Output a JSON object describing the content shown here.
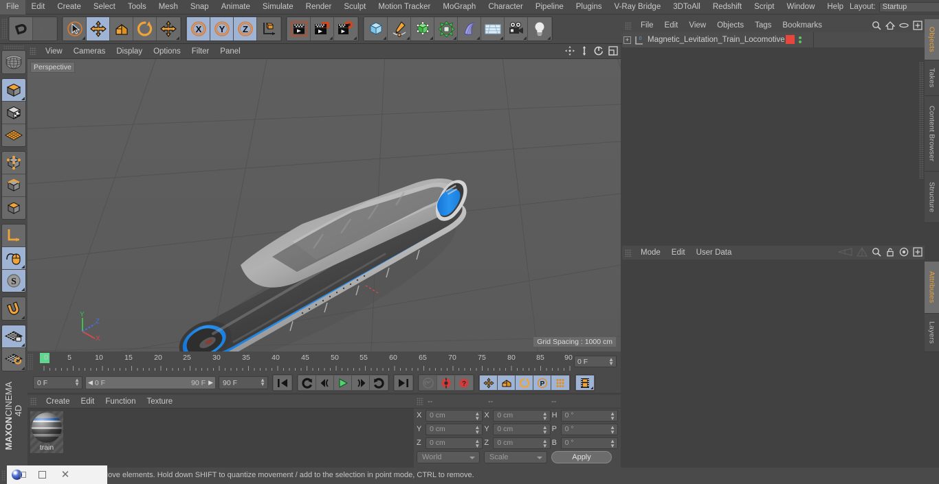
{
  "app": {
    "brand_top": "MAXON",
    "brand_bottom": "CINEMA 4D"
  },
  "menubar": {
    "items": [
      "File",
      "Edit",
      "Create",
      "Select",
      "Tools",
      "Mesh",
      "Snap",
      "Animate",
      "Simulate",
      "Render",
      "Sculpt",
      "Motion Tracker",
      "MoGraph",
      "Character",
      "Pipeline",
      "Plugins",
      "V-Ray Bridge",
      "3DToAll",
      "Redshift",
      "Script",
      "Window",
      "Help"
    ],
    "layout_label": "Layout:",
    "layout_value": "Startup",
    "search_icon": "search-icon"
  },
  "toolbar": {
    "groups": [
      {
        "name": "undo-redo",
        "buttons": [
          {
            "name": "undo-button",
            "icon": "undo-arrow-icon",
            "active": false,
            "dim": false
          },
          {
            "name": "redo-button",
            "icon": "redo-arrow-icon",
            "active": false,
            "dim": true
          }
        ]
      },
      {
        "name": "transform-tools",
        "buttons": [
          {
            "name": "live-selection-tool",
            "icon": "cursor-select-icon",
            "active": false,
            "corner": true
          },
          {
            "name": "move-tool",
            "icon": "move-arrows-icon",
            "active": true
          },
          {
            "name": "scale-tool",
            "icon": "scale-box-icon",
            "active": false
          },
          {
            "name": "rotate-tool",
            "icon": "rotate-circle-icon",
            "active": false
          },
          {
            "name": "move-alt-tool",
            "icon": "move-arrows-icon",
            "active": false,
            "corner": true
          }
        ]
      },
      {
        "name": "axis-locks",
        "buttons": [
          {
            "name": "lock-x-axis",
            "icon": "x-axis-icon",
            "active": true
          },
          {
            "name": "lock-y-axis",
            "icon": "y-axis-icon",
            "active": true
          },
          {
            "name": "lock-z-axis",
            "icon": "z-axis-icon",
            "active": true
          },
          {
            "name": "world-object-coordinates",
            "icon": "world-axis-icon",
            "active": false
          }
        ]
      },
      {
        "name": "render-group",
        "buttons": [
          {
            "name": "render-view-button",
            "icon": "render-view-icon",
            "active": false
          },
          {
            "name": "render-to-picture-viewer-button",
            "icon": "render-picture-icon",
            "active": false,
            "corner": true
          },
          {
            "name": "render-settings-button",
            "icon": "render-settings-icon",
            "active": false,
            "corner": true
          }
        ]
      },
      {
        "name": "create-group",
        "buttons": [
          {
            "name": "add-cube-button",
            "icon": "cube-primitive-icon",
            "active": false,
            "corner": true
          },
          {
            "name": "add-spline-button",
            "icon": "pen-spline-icon",
            "active": false,
            "corner": true
          },
          {
            "name": "add-generator-button",
            "icon": "generator-cube-icon",
            "active": false,
            "corner": true
          },
          {
            "name": "add-deformer-button",
            "icon": "deformer-icon",
            "active": false,
            "corner": true
          },
          {
            "name": "add-scene-object-button",
            "icon": "bend-object-icon",
            "active": false,
            "corner": true
          },
          {
            "name": "add-floor-button",
            "icon": "floor-grid-icon",
            "active": false,
            "corner": true
          },
          {
            "name": "add-camera-button",
            "icon": "camera-icon",
            "active": false,
            "corner": true
          },
          {
            "name": "add-light-button",
            "icon": "light-bulb-icon",
            "active": false,
            "corner": true
          }
        ]
      }
    ]
  },
  "left_toolbar": {
    "groups": [
      {
        "name": "render-region",
        "buttons": [
          {
            "name": "render-region-button",
            "icon": "globe-wire-icon",
            "active": false
          }
        ]
      },
      {
        "name": "editable-modes",
        "buttons": [
          {
            "name": "make-editable-button",
            "icon": "editable-cube-icon",
            "active": true,
            "corner": true
          },
          {
            "name": "texture-mode-button",
            "icon": "texture-checker-cube-icon",
            "active": false
          },
          {
            "name": "viewport-solo-button",
            "icon": "grid-plane-icon",
            "active": false
          }
        ]
      },
      {
        "name": "component-modes",
        "buttons": [
          {
            "name": "point-mode-button",
            "icon": "points-cube-icon",
            "active": false
          },
          {
            "name": "edge-mode-button",
            "icon": "edges-cube-icon",
            "active": false
          },
          {
            "name": "polygon-mode-button",
            "icon": "polygon-cube-icon",
            "active": false
          }
        ]
      },
      {
        "name": "axis-modes",
        "buttons": [
          {
            "name": "enable-axis-modification-button",
            "icon": "axis-l-icon",
            "active": false
          },
          {
            "name": "enable-snapping-mouse-button",
            "icon": "mouse-icon",
            "active": true,
            "corner": true
          },
          {
            "name": "soft-selection-button",
            "icon": "s-sphere-icon",
            "active": true,
            "corner": true
          }
        ]
      },
      {
        "name": "snap-group",
        "buttons": [
          {
            "name": "snap-magnet-button",
            "icon": "magnet-icon",
            "active": false,
            "corner": true
          }
        ]
      },
      {
        "name": "workplane-group",
        "buttons": [
          {
            "name": "lock-workplane-button",
            "icon": "workplane-lock-icon",
            "active": true,
            "corner": true
          },
          {
            "name": "workplane-rotate-button",
            "icon": "workplane-rotate-icon",
            "active": false,
            "corner": true
          }
        ]
      }
    ]
  },
  "viewport": {
    "menu": [
      "View",
      "Cameras",
      "Display",
      "Options",
      "Filter",
      "Panel"
    ],
    "view_label": "Perspective",
    "grid_spacing": "Grid Spacing : 1000 cm",
    "axis_gizmo": {
      "x": "X",
      "y": "Y",
      "z": "Z"
    },
    "corner_icons": [
      "pan-view-icon",
      "dolly-view-icon",
      "rotate-view-icon",
      "maximize-view-icon"
    ]
  },
  "timeline": {
    "ticks": [
      "0",
      "5",
      "10",
      "15",
      "20",
      "25",
      "30",
      "35",
      "40",
      "45",
      "50",
      "55",
      "60",
      "65",
      "70",
      "75",
      "80",
      "85",
      "90"
    ],
    "current_frame_top": "0 F",
    "current_frame": "0 F",
    "range_start": "0 F",
    "range_end": "90 F",
    "end_frame": "90 F",
    "transport": [
      {
        "name": "go-to-start-button",
        "icon": "skip-start-icon"
      },
      {
        "name": "play-reverse-loop-button",
        "icon": "loop-reverse-icon"
      },
      {
        "name": "step-back-button",
        "icon": "step-back-icon"
      },
      {
        "name": "play-button",
        "icon": "play-icon"
      },
      {
        "name": "step-forward-button",
        "icon": "step-forward-icon"
      },
      {
        "name": "play-forward-loop-button",
        "icon": "loop-forward-icon"
      },
      {
        "name": "go-to-end-button",
        "icon": "skip-end-icon"
      }
    ],
    "record_group": [
      {
        "name": "autokeying-button",
        "icon": "key-icon",
        "dim": true
      },
      {
        "name": "record-active-objects-button",
        "icon": "record-circle-icon"
      },
      {
        "name": "keyframe-selection-button",
        "icon": "question-circle-icon"
      }
    ],
    "key_group": [
      {
        "name": "position-key-button",
        "icon": "position-move-icon",
        "active": true
      },
      {
        "name": "scale-key-button",
        "icon": "scale-key-icon",
        "active": true
      },
      {
        "name": "rotation-key-button",
        "icon": "rotation-key-icon",
        "active": true
      },
      {
        "name": "parameter-key-button",
        "icon": "p-circle-icon",
        "active": true
      },
      {
        "name": "pla-key-button",
        "icon": "point-level-anim-icon",
        "active": true
      }
    ],
    "level_of_detail": {
      "name": "animation-mode-button",
      "icon": "film-strip-icon",
      "active": true
    }
  },
  "material_manager": {
    "menu": [
      "Create",
      "Edit",
      "Function",
      "Texture"
    ],
    "materials": [
      {
        "name": "train"
      }
    ]
  },
  "coordinates": {
    "header_dashes": [
      "--",
      "--",
      "--"
    ],
    "rows": [
      {
        "pos_label": "X",
        "pos_value": "0 cm",
        "size_label": "X",
        "size_value": "0 cm",
        "rot_label": "H",
        "rot_value": "0 °"
      },
      {
        "pos_label": "Y",
        "pos_value": "0 cm",
        "size_label": "Y",
        "size_value": "0 cm",
        "rot_label": "P",
        "rot_value": "0 °"
      },
      {
        "pos_label": "Z",
        "pos_value": "0 cm",
        "size_label": "Z",
        "size_value": "0 cm",
        "rot_label": "B",
        "rot_value": "0 °"
      }
    ],
    "coord_system": "World",
    "size_mode": "Scale",
    "apply_label": "Apply"
  },
  "object_manager": {
    "menu": [
      "File",
      "Edit",
      "View",
      "Objects",
      "Tags",
      "Bookmarks"
    ],
    "icons": [
      "search-icon",
      "home-icon",
      "ellipse-icon",
      "plus-box-icon"
    ],
    "objects": [
      {
        "name": "Magnetic_Levitation_Train_Locomotive",
        "level_icon": "null-object-icon",
        "tag_color": "#e8453c"
      }
    ]
  },
  "attribute_manager": {
    "menu": [
      "Mode",
      "Edit",
      "User Data"
    ],
    "icons": [
      "back-nav-icon",
      "forward-nav-icon",
      "search-icon",
      "lock-icon",
      "target-icon",
      "plus-box-icon"
    ]
  },
  "right_tabs": [
    {
      "label": "Objects",
      "selected": true
    },
    {
      "label": "Takes",
      "selected": false
    },
    {
      "label": "Content Browser",
      "selected": false
    },
    {
      "label": "Structure",
      "selected": false
    },
    {
      "label": "Attributes",
      "selected": true
    },
    {
      "label": "Layers",
      "selected": false
    }
  ],
  "statusbar": {
    "message": "Move elements. Hold down SHIFT to quantize movement / add to the selection in point mode, CTRL to remove."
  },
  "taskbar": {
    "items": [
      "c4d-logo-icon",
      "restore-window-icon",
      "close-window-icon"
    ]
  },
  "colors": {
    "accent_orange": "#e8a23c",
    "active_blue": "#9fb4d4",
    "train_blue": "#1f86e0",
    "panel_bg": "#4a4a4a",
    "viewport_bg": "#5c5c5c",
    "tag_red": "#e8453c",
    "play_green": "#4fd46f",
    "record_red": "#d43c3c"
  }
}
